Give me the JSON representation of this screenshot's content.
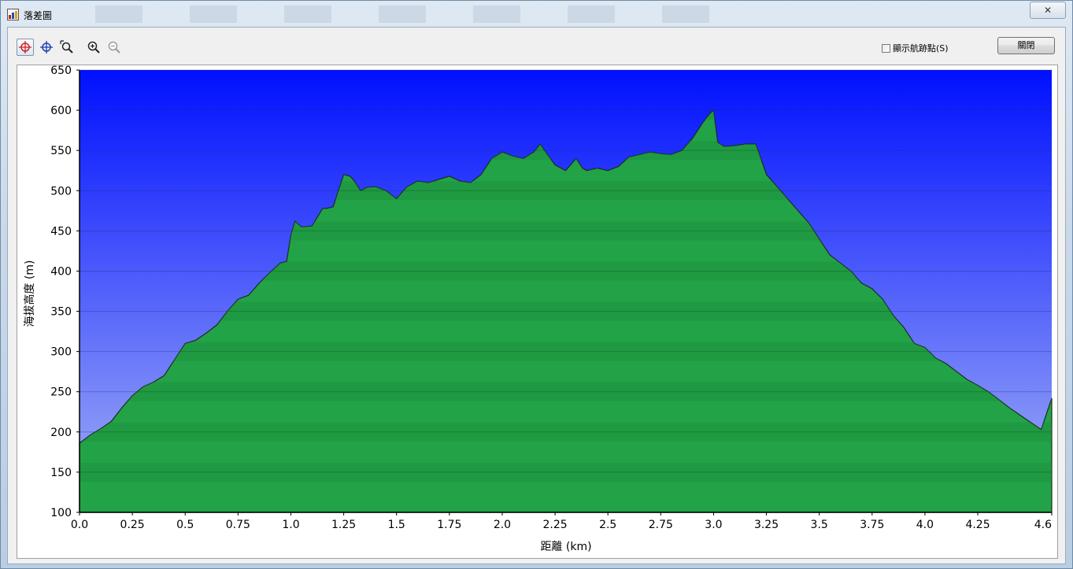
{
  "window": {
    "title": "落差圖",
    "close_glyph": "✕"
  },
  "toolbar": {
    "tools": [
      {
        "name": "crosshair-red-tool-icon",
        "color": "#d22222"
      },
      {
        "name": "crosshair-blue-tool-icon",
        "color": "#1f3fb0"
      },
      {
        "name": "zoom-select-tool-icon",
        "color": "#222222"
      },
      {
        "name": "zoom-in-icon",
        "color": "#222222"
      },
      {
        "name": "zoom-out-icon",
        "color": "#9a9a9a"
      }
    ],
    "show_waypoints_label": "顯示航跡點(S)",
    "show_waypoints_checked": false,
    "close_label": "關閉"
  },
  "colors": {
    "sky_top": "#0012ff",
    "sky_bottom": "#9aaaf8",
    "terrain": "#22a348",
    "terrain_band": "#1b8a3a",
    "outline": "#1f2b1f"
  },
  "chart_data": {
    "type": "area",
    "xlabel": "距離 (km)",
    "ylabel": "海拔高度 (m)",
    "xlim": [
      0,
      4.6
    ],
    "ylim": [
      100,
      650
    ],
    "x_ticks": [
      "0.0",
      "0.25",
      "0.5",
      "0.75",
      "1.0",
      "1.25",
      "1.5",
      "1.75",
      "2.0",
      "2.25",
      "2.5",
      "2.75",
      "3.0",
      "3.25",
      "3.5",
      "3.75",
      "4.0",
      "4.25",
      "4.6"
    ],
    "x_tick_values": [
      0,
      0.25,
      0.5,
      0.75,
      1.0,
      1.25,
      1.5,
      1.75,
      2.0,
      2.25,
      2.5,
      2.75,
      3.0,
      3.25,
      3.5,
      3.75,
      4.0,
      4.25,
      4.6
    ],
    "y_ticks": [
      100,
      150,
      200,
      250,
      300,
      350,
      400,
      450,
      500,
      550,
      600,
      650
    ],
    "grid": true,
    "x": [
      0,
      0.05,
      0.1,
      0.15,
      0.2,
      0.25,
      0.3,
      0.35,
      0.4,
      0.45,
      0.5,
      0.55,
      0.6,
      0.65,
      0.7,
      0.75,
      0.8,
      0.85,
      0.9,
      0.95,
      0.98,
      1.0,
      1.02,
      1.05,
      1.1,
      1.15,
      1.17,
      1.2,
      1.25,
      1.28,
      1.3,
      1.33,
      1.36,
      1.4,
      1.45,
      1.5,
      1.55,
      1.6,
      1.65,
      1.7,
      1.75,
      1.8,
      1.85,
      1.9,
      1.95,
      2.0,
      2.05,
      2.1,
      2.15,
      2.18,
      2.2,
      2.25,
      2.3,
      2.35,
      2.38,
      2.4,
      2.45,
      2.5,
      2.55,
      2.6,
      2.65,
      2.7,
      2.75,
      2.8,
      2.85,
      2.9,
      2.95,
      2.98,
      3.0,
      3.02,
      3.05,
      3.1,
      3.15,
      3.2,
      3.25,
      3.3,
      3.35,
      3.4,
      3.45,
      3.5,
      3.55,
      3.6,
      3.65,
      3.7,
      3.75,
      3.8,
      3.85,
      3.9,
      3.95,
      4.0,
      4.05,
      4.1,
      4.15,
      4.2,
      4.25,
      4.3,
      4.35,
      4.4,
      4.45,
      4.5,
      4.55,
      4.6
    ],
    "values": [
      186,
      196,
      204,
      213,
      230,
      245,
      256,
      262,
      270,
      290,
      310,
      314,
      323,
      333,
      350,
      365,
      370,
      385,
      398,
      410,
      412,
      445,
      462,
      455,
      456,
      478,
      478,
      480,
      520,
      518,
      512,
      500,
      504,
      505,
      500,
      490,
      505,
      512,
      510,
      514,
      518,
      512,
      510,
      520,
      540,
      548,
      543,
      540,
      548,
      558,
      550,
      532,
      525,
      540,
      528,
      525,
      528,
      525,
      530,
      542,
      545,
      548,
      546,
      545,
      550,
      565,
      585,
      595,
      600,
      560,
      555,
      556,
      558,
      558,
      520,
      505,
      490,
      475,
      460,
      440,
      420,
      410,
      400,
      385,
      378,
      365,
      345,
      330,
      310,
      305,
      292,
      285,
      275,
      265,
      258,
      250,
      240,
      230,
      221,
      212,
      203,
      242
    ]
  }
}
